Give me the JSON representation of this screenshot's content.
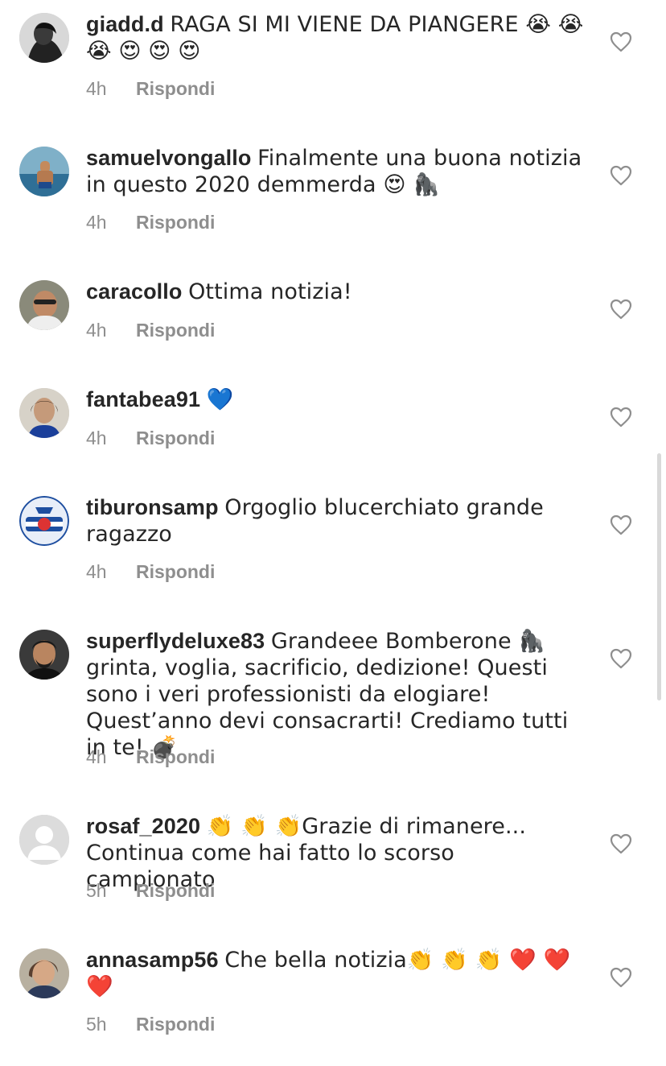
{
  "comments": [
    {
      "username": "giadd.d",
      "text": "RAGA SI MI VIENE DA PIANGERE 😭 😭 😭 😍 😍 😍",
      "time": "4h",
      "reply": "Rispondi"
    },
    {
      "username": "samuelvongallo",
      "text": "Finalmente una buona notizia in questo 2020 demmerda 😍 🦍",
      "time": "4h",
      "reply": "Rispondi"
    },
    {
      "username": "caracollo",
      "text": "Ottima notizia!",
      "time": "4h",
      "reply": "Rispondi"
    },
    {
      "username": "fantabea91",
      "text": "💙",
      "time": "4h",
      "reply": "Rispondi"
    },
    {
      "username": "tiburonsamp",
      "text": "Orgoglio blucerchiato grande ragazzo",
      "time": "4h",
      "reply": "Rispondi"
    },
    {
      "username": "superflydeluxe83",
      "text": "Grandeee Bomberone 🦍 grinta, voglia, sacrificio, dedizione! Questi sono i veri professionisti da elogiare! Quest’anno devi consacrarti! Crediamo tutti in te! 💣",
      "time": "4h",
      "reply": "Rispondi"
    },
    {
      "username": "rosaf_2020",
      "text": "👏 👏 👏Grazie di rimanere... Continua come hai fatto lo scorso campionato",
      "time": "5h",
      "reply": "Rispondi"
    },
    {
      "username": "annasamp56",
      "text": "Che bella notizia👏 👏 👏 ❤️ ❤️ ❤️",
      "time": "5h",
      "reply": "Rispondi"
    }
  ],
  "icons": {
    "like": "heart-outline-icon"
  },
  "colors": {
    "text": "#262626",
    "meta": "#8e8e8e",
    "background": "#ffffff"
  }
}
